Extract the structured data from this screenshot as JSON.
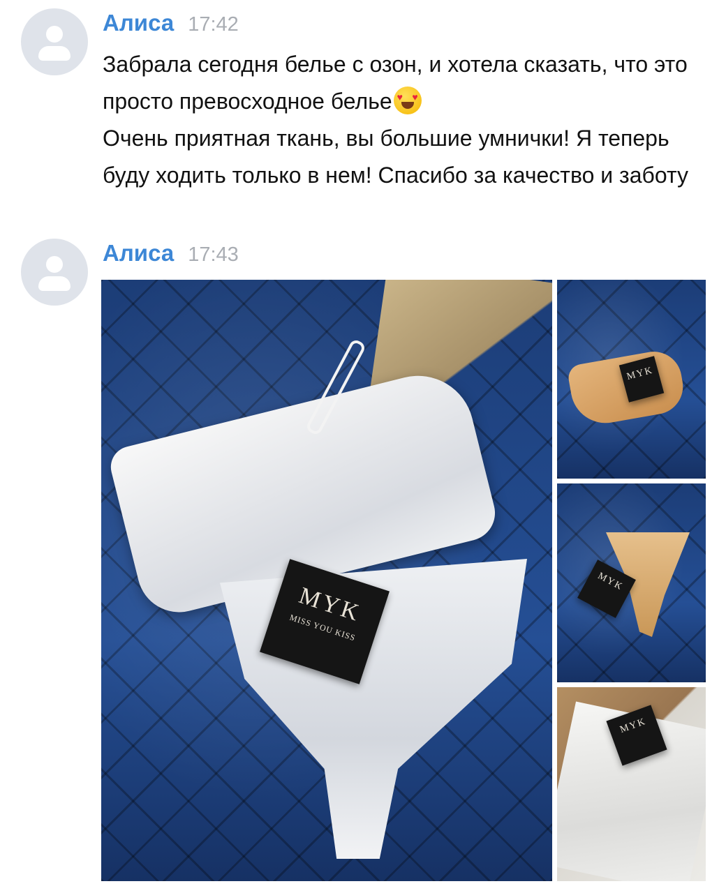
{
  "messages": [
    {
      "author": "Алиса",
      "time": "17:42",
      "lines": [
        "Забрала сегодня белье с озон, и хотела сказать, что это просто превосходное белье",
        "Очень приятная ткань, вы большие умнички! Я теперь буду ходить только в нем! Спасибо за качество и заботу"
      ],
      "emoji": "heart-eyes-emoji"
    },
    {
      "author": "Алиса",
      "time": "17:43",
      "photos": [
        {
          "tag_logo": "MYK",
          "tag_text": "MISS YOU KISS"
        },
        {
          "tag_logo": "MYK"
        },
        {
          "tag_logo": "MYK"
        },
        {
          "tag_logo": "MYK"
        }
      ]
    }
  ],
  "colors": {
    "author": "#3d87d6",
    "time": "#a9adb3",
    "text": "#111111",
    "avatar_bg": "#dfe3ea"
  }
}
